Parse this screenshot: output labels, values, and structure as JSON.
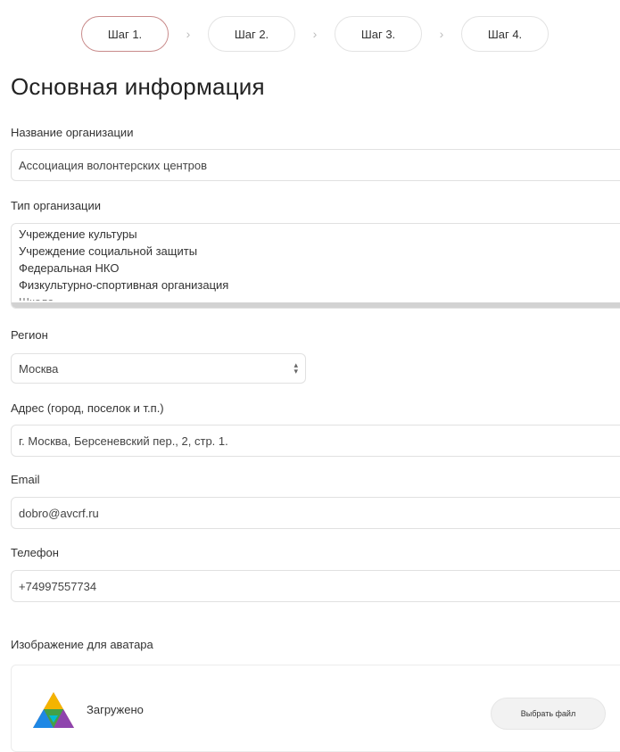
{
  "steps": [
    {
      "label": "Шаг 1.",
      "active": true
    },
    {
      "label": "Шаг 2.",
      "active": false
    },
    {
      "label": "Шаг 3.",
      "active": false
    },
    {
      "label": "Шаг 4.",
      "active": false
    }
  ],
  "step_separator_icon": "chevron-right-icon",
  "page_title": "Основная информация",
  "org_name": {
    "label": "Название организации",
    "value": "Ассоциация волонтерских центров"
  },
  "org_type": {
    "label": "Тип организации",
    "options": [
      "Учреждение культуры",
      "Учреждение социальной защиты",
      "Федеральная НКО",
      "Физкультурно-спортивная организация",
      "Школа"
    ]
  },
  "region": {
    "label": "Регион",
    "value": "Москва",
    "icon": "select-arrows-icon"
  },
  "address": {
    "label": "Адрес (город, поселок и т.п.)",
    "value": "г. Москва, Берсеневский пер., 2, стр. 1."
  },
  "email": {
    "label": "Email",
    "value": "dobro@avcrf.ru"
  },
  "phone": {
    "label": "Телефон",
    "value": "+74997557734"
  },
  "avatar": {
    "label": "Изображение для аватара",
    "status": "Загружено",
    "button": "Выбрать файл",
    "icon": "avatar-logo-icon"
  },
  "colors": {
    "active_step_border": "#c98b8b",
    "border": "#e1e1e1",
    "listbox_selection": "#d2d2d2",
    "button_bg": "#f2f2f2"
  }
}
